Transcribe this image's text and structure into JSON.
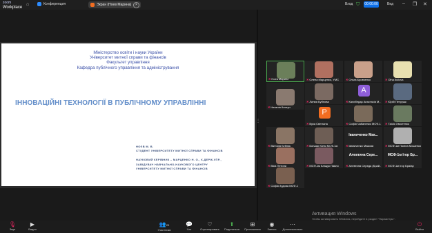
{
  "app": {
    "logo_top": "zoom",
    "logo_bottom": "Workplace"
  },
  "tabs": {
    "conference": "Конференция",
    "share": "Экран (Ноев Марина)"
  },
  "top_right": {
    "login": "Вход",
    "timer": "00:00:00",
    "view": "Вид"
  },
  "slide": {
    "header": [
      "Міністерство освіти і науки України",
      "Університет митної справи та фінансів",
      "Факультет управління",
      "Кафедра публічного управління та адміністрування"
    ],
    "title": "ІННОВАЦІЙНІ ТЕХНОЛОГІЇ В ПУБЛІЧНОМУ УПРАВЛІННІ",
    "author_lines": [
      "НОЄВ М. В.",
      "СТУДЕНТ УНІВЕРСИТЕТУ МИТНОЇ СПРАВИ ТА ФІНАНСІВ"
    ],
    "advisor_lines": [
      "НАУКОВИЙ КЕРІВНИК – МАРЦЕНКО Н. О., К.ДЕРЖ.УПР.,",
      "ЗАВІДУВАЧ НАВЧАЛЬНО-НАУКОВОГО ЦЕНТРУ",
      "УНІВЕРСИТЕТУ МИТНОЇ СПРАВИ ТА ФІНАНСІВ"
    ]
  },
  "participants": [
    {
      "name": "Ноев Марина",
      "kind": "video",
      "color": "#6b7f5a"
    },
    {
      "name": "Олена Марценко, УМС",
      "kind": "video",
      "color": "#b07060"
    },
    {
      "name": "Ольга Бровченко",
      "kind": "video",
      "color": "#c9a08a"
    },
    {
      "name": "Olha Avilova",
      "kind": "video",
      "color": "#e8e0b0"
    },
    {
      "name": "Наталія Коляда",
      "kind": "text",
      "big": "Наталія Коятун"
    },
    {
      "name": "Наталія Коятун",
      "kind": "video",
      "color": "#8a7a70"
    },
    {
      "name": "Лилия Бубнова",
      "kind": "video",
      "color": "#7b6a62"
    },
    {
      "name": "Калиберда Анастасія М..",
      "kind": "avatar",
      "letter": "A",
      "color": "#8e5ed8"
    },
    {
      "name": "Юрій Петрушк",
      "kind": "video",
      "color": "#5a6a80"
    },
    {
      "name": "Вікторія Бублик",
      "kind": "video",
      "color": "#8a7565"
    },
    {
      "name": "Вука Світлана",
      "kind": "avatar",
      "letter": "Р",
      "color": "#f26d21"
    },
    {
      "name": "Софія Чабаненко МСФ-1",
      "kind": "video",
      "color": "#7a6a5a"
    },
    {
      "name": "Таісія Хвостенко",
      "kind": "video",
      "color": "#6a7a60"
    },
    {
      "name": "Віра Петрукі",
      "kind": "video",
      "color": "#9a7060"
    },
    {
      "name": "Бондар Юлія МСФ-1м",
      "kind": "video",
      "color": "#6e5e55"
    },
    {
      "name": "Іваниченко Максим",
      "kind": "text",
      "big": "Іваниченко Мак..."
    },
    {
      "name": "МСФ-1м Поліна Мощенко",
      "kind": "video",
      "color": "#b0b0b0"
    },
    {
      "name": "Софія Зудова МСФ-1",
      "kind": "video",
      "color": "#7a6050"
    },
    {
      "name": "МСФ-1м Бліщук Павло",
      "kind": "video",
      "color": "#7a5a60"
    },
    {
      "name": "Алевтина Середа (Брай..",
      "kind": "text",
      "big": "Алевтина Сере..."
    },
    {
      "name": "МСФ-1м Ігор Браїар",
      "kind": "text",
      "big": "МСФ-1м Ігор Бр..."
    }
  ],
  "toolbar": [
    {
      "label": "Звук",
      "icon": "mic-muted-icon"
    },
    {
      "label": "Видео",
      "icon": "video-icon"
    },
    {
      "label": "Участники",
      "icon": "participants-icon",
      "count": "20"
    },
    {
      "label": "Чат",
      "icon": "chat-icon"
    },
    {
      "label": "Отреагировать",
      "icon": "reaction-icon"
    },
    {
      "label": "Поделиться",
      "icon": "share-icon"
    },
    {
      "label": "Приложения",
      "icon": "apps-icon"
    },
    {
      "label": "Запись",
      "icon": "record-icon"
    },
    {
      "label": "Дополнительно",
      "icon": "more-icon"
    },
    {
      "label": "Выйти",
      "icon": "leave-icon"
    }
  ],
  "watermark": {
    "title": "Активация Windows",
    "subtitle": "Чтобы активировать Windows, перейдите в раздел \"Параметры\"."
  }
}
